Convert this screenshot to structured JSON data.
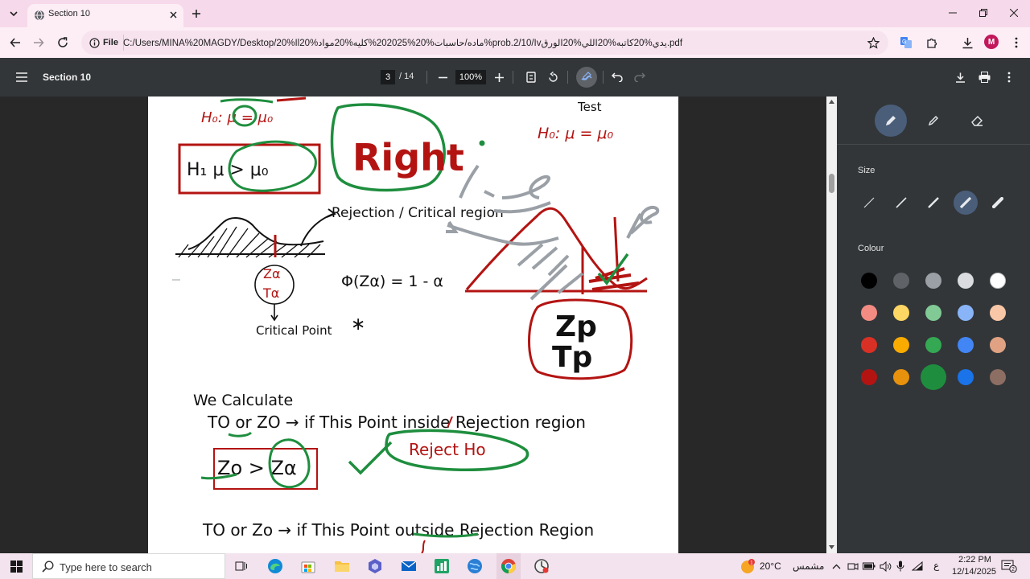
{
  "browser": {
    "tab": {
      "title": "Section 10",
      "favicon": "globe-icon"
    },
    "address": {
      "scheme_chip": "File",
      "url": "C:/Users/MINA%20MAGDY/Desktop/20%اl20%ماده/حاسبات%20%202025%كليه%20مواد%prob.2/10/اvيدي%20كاتبه%20اللي%20الورق.pdf"
    },
    "profile_initial": "M",
    "colors": {
      "tabstrip": "#f6d9ea",
      "toolbar": "#fdeef6",
      "avatar": "#c2185b"
    }
  },
  "pdf": {
    "title": "Section 10",
    "page_current": "3",
    "page_total": "/ 14",
    "zoom": "100%"
  },
  "document": {
    "notes": {
      "h0_topleft": "H₀: μ = μ₀",
      "test_label": "Test",
      "h0_right": "H₀: μ = μ₀",
      "h1_box": "H₁ μ > μ₀",
      "right_label": "Right",
      "rejection_region_label": "Rejection / Critical region",
      "z_alpha_top": "Zα",
      "t_alpha": "Tα",
      "critical_point": "Critical Point",
      "phi_eq": "Φ(Zα) = 1 - α",
      "star_note": "∗",
      "zp_label": "Zp",
      "tp_label": "Tp",
      "we_calculate": "We Calculate",
      "line1": "TO or ZO → if This Point inside Rejection region",
      "compare": "Zo > Zα",
      "reject_h0": "Reject Ho",
      "line2": "TO or Zo → if This Point outside Rejection Region"
    }
  },
  "annotation_panel": {
    "size_label": "Size",
    "colour_label": "Colour",
    "palette": [
      [
        "#000000",
        "#5f6368",
        "#9aa0a6",
        "#dadce0",
        "#ffffff"
      ],
      [
        "#f28b82",
        "#fdd663",
        "#81c995",
        "#8ab4f8",
        "#f8c7a7"
      ],
      [
        "#d93025",
        "#f9ab00",
        "#34a853",
        "#4285f4",
        "#e0a283"
      ],
      [
        "#b31412",
        "#e8910c",
        "#1e8e3e",
        "#1a73e8",
        "#8d6e63"
      ]
    ],
    "selected_color": "#1e8e3e"
  },
  "taskbar": {
    "search_placeholder": "Type here to search",
    "weather_temp": "20°C",
    "weather_text": "مشمس",
    "weather_badge": "1",
    "lang": "ع",
    "time": "2:22 PM",
    "date": "12/14/2025",
    "notif_count": "2"
  }
}
